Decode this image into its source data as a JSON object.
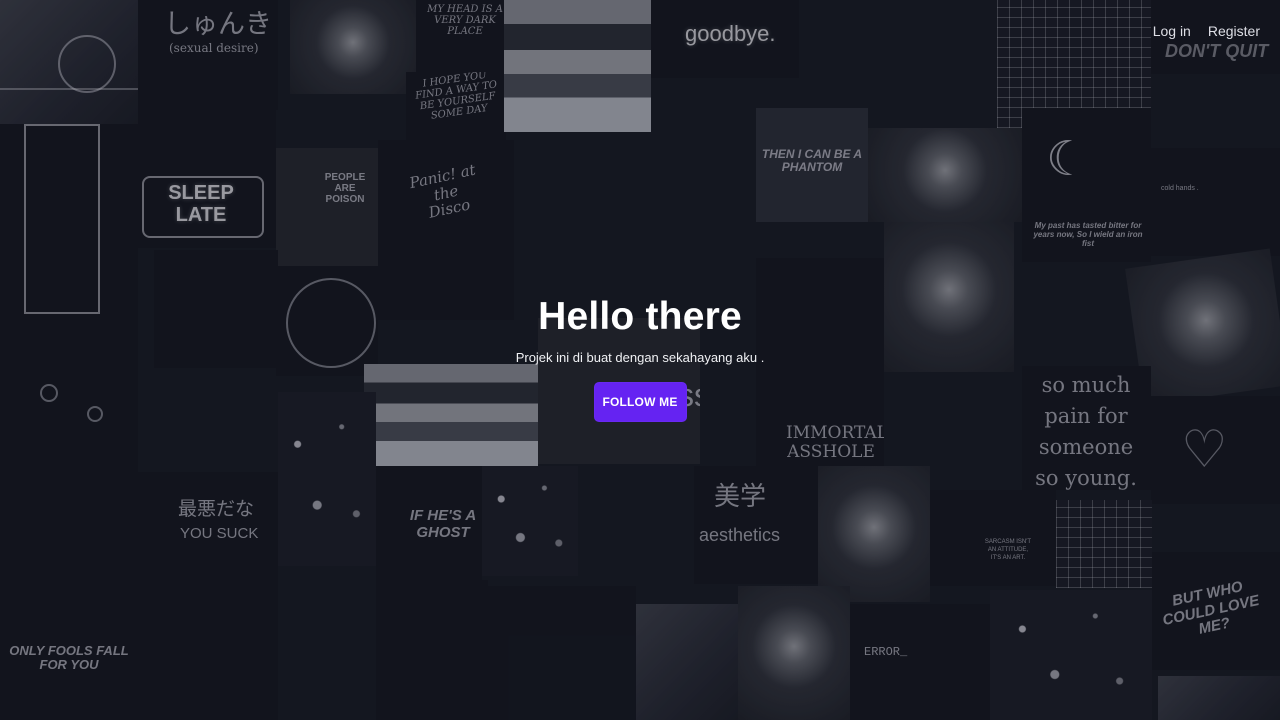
{
  "navigation": {
    "login_label": "Log in",
    "register_label": "Register"
  },
  "hero": {
    "title": "Hello there",
    "subtitle": "Projek ini di buat dengan sekahayang aku .",
    "button_label": "FOLLOW ME"
  },
  "background": {
    "tile_texts": [
      "しゅんき",
      "(sexual desire)",
      "MY HEAD IS A VERY DARK PLACE",
      "I HOPE YOU FIND A WAY TO BE YOURSELF SOME DAY",
      "goodbye.",
      "DON'T QUIT",
      "SLEEP LATE",
      "PEOPLE ARE POISON",
      "Panic! at the Disco",
      "THEN I CAN BE A PHANTOM",
      "cold hands .",
      "My past has tasted bitter for years now, So I wield an iron fist",
      "sssh",
      "IMMORTAL ASSHOLE",
      "so much pain for someone so young.",
      "最悪だな",
      "YOU SUCK",
      "IF HE'S A GHOST",
      "美学",
      "aesthetics",
      "SARCASM ISN'T AN ATTITUDE, IT'S AN ART.",
      "BUT WHO COULD LOVE ME?",
      "ONLY FOOLS FALL FOR YOU",
      "ERROR_"
    ]
  },
  "colors": {
    "background": "#171a24",
    "button": "#6523f2",
    "text": "#ffffff"
  }
}
